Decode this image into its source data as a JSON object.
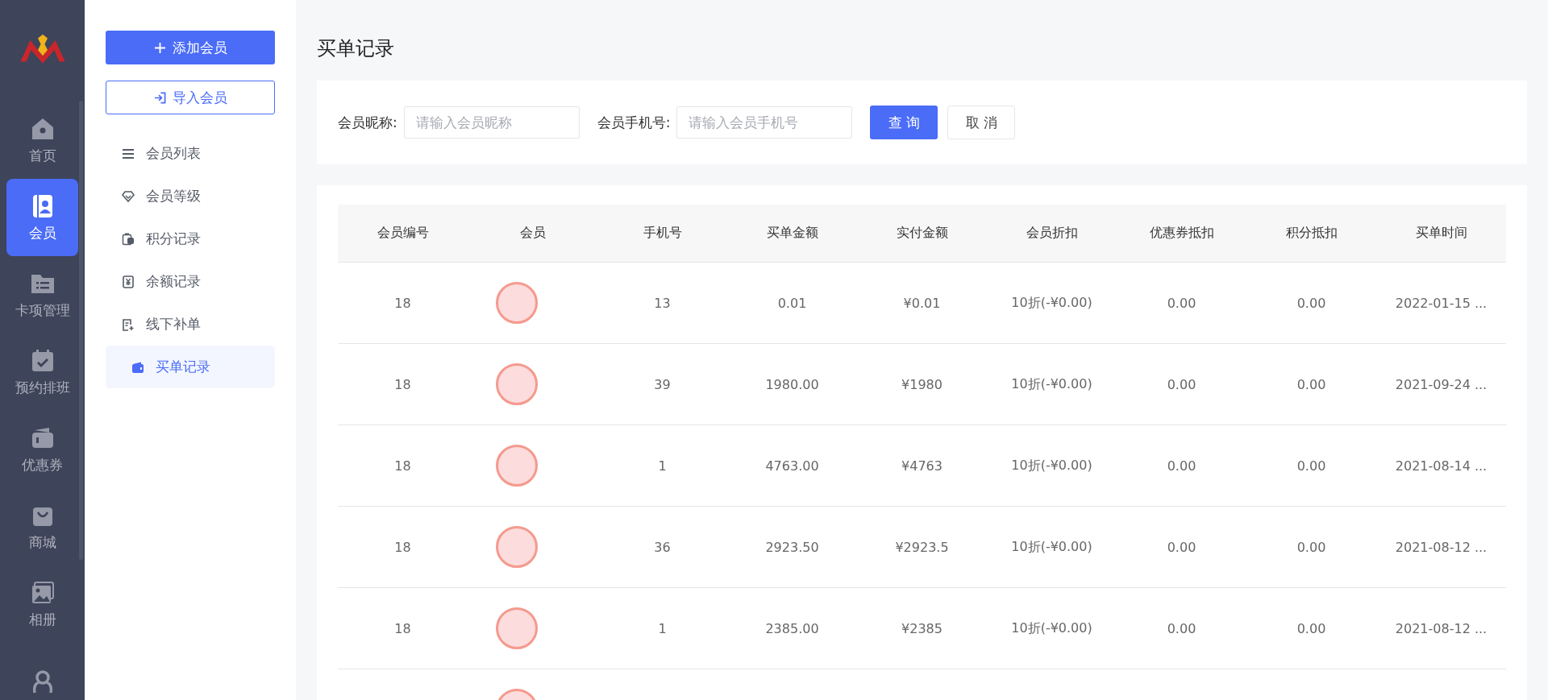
{
  "nav": {
    "items": [
      {
        "label": "首页",
        "kind": "home",
        "selected": false
      },
      {
        "label": "会员",
        "kind": "member",
        "selected": true
      },
      {
        "label": "卡项管理",
        "kind": "folder",
        "selected": false
      },
      {
        "label": "预约排班",
        "kind": "calendar",
        "selected": false
      },
      {
        "label": "优惠券",
        "kind": "wallet",
        "selected": false
      },
      {
        "label": "商城",
        "kind": "bag",
        "selected": false
      },
      {
        "label": "相册",
        "kind": "photo",
        "selected": false
      },
      {
        "kind": "people",
        "selected": false
      }
    ]
  },
  "submenu": {
    "add_button": "添加会员",
    "import_button": "导入会员",
    "items": [
      {
        "label": "会员列表",
        "kind": "list",
        "selected": false
      },
      {
        "label": "会员等级",
        "kind": "diamond",
        "selected": false
      },
      {
        "label": "积分记录",
        "kind": "points",
        "selected": false
      },
      {
        "label": "余额记录",
        "kind": "yen",
        "selected": false
      },
      {
        "label": "线下补单",
        "kind": "addnote",
        "selected": false
      },
      {
        "label": "买单记录",
        "kind": "wallet",
        "selected": true
      }
    ]
  },
  "page_title": "买单记录",
  "filters": [
    {
      "label": "会员昵称:",
      "placeholder": "请输入会员昵称"
    },
    {
      "label": "会员手机号:",
      "placeholder": "请输入会员手机号"
    }
  ],
  "query_button": "查 询",
  "cancel_button": "取 消",
  "table": {
    "columns": [
      "会员编号",
      "会员",
      "手机号",
      "买单金额",
      "实付金额",
      "会员折扣",
      "优惠券抵扣",
      "积分抵扣",
      "买单时间"
    ],
    "rows": [
      {
        "kind": "record",
        "id": "18",
        "phone": "13",
        "amount": "0.01",
        "paid": "¥0.01",
        "discount": "10折(-¥0.00)",
        "coupon": "0.00",
        "points": "0.00",
        "time": "2022-01-15 ..."
      },
      {
        "kind": "record",
        "id": "18",
        "phone": "39",
        "amount": "1980.00",
        "paid": "¥1980",
        "discount": "10折(-¥0.00)",
        "coupon": "0.00",
        "points": "0.00",
        "time": "2021-09-24 ..."
      },
      {
        "kind": "record",
        "id": "18",
        "phone": "1",
        "amount": "4763.00",
        "paid": "¥4763",
        "discount": "10折(-¥0.00)",
        "coupon": "0.00",
        "points": "0.00",
        "time": "2021-08-14 ..."
      },
      {
        "kind": "record",
        "id": "18",
        "phone": "36",
        "amount": "2923.50",
        "paid": "¥2923.5",
        "discount": "10折(-¥0.00)",
        "coupon": "0.00",
        "points": "0.00",
        "time": "2021-08-12 ..."
      },
      {
        "kind": "record",
        "id": "18",
        "phone": "1",
        "amount": "2385.00",
        "paid": "¥2385",
        "discount": "10折(-¥0.00)",
        "coupon": "0.00",
        "points": "0.00",
        "time": "2021-08-12 ..."
      },
      {
        "kind": "partial"
      }
    ]
  }
}
